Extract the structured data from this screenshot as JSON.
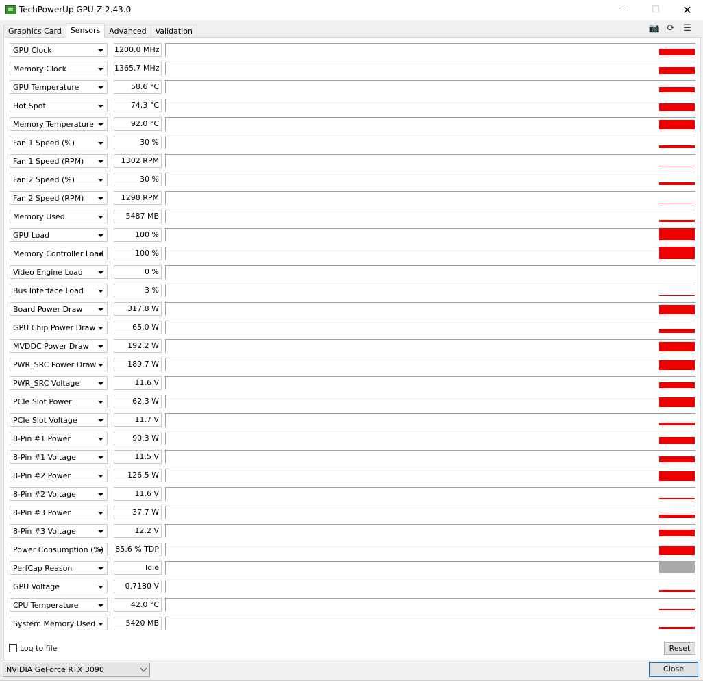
{
  "window": {
    "title": "TechPowerUp GPU-Z 2.43.0",
    "min_glyph": "—",
    "max_glyph": "☐",
    "close_glyph": "✕"
  },
  "tabs": [
    {
      "label": "Graphics Card"
    },
    {
      "label": "Sensors",
      "active": true
    },
    {
      "label": "Advanced"
    },
    {
      "label": "Validation"
    }
  ],
  "toolbar": {
    "camera_glyph": "📷",
    "refresh_glyph": "⟳",
    "menu_glyph": "☰"
  },
  "accent_colors": {
    "graph": "#ec0000",
    "graph_inactive": "#a9a9a9"
  },
  "sensors": [
    {
      "name": "GPU Clock",
      "value": "1200.0 MHz",
      "level": 0.55
    },
    {
      "name": "Memory Clock",
      "value": "1365.7 MHz",
      "level": 0.55
    },
    {
      "name": "GPU Temperature",
      "value": "58.6 °C",
      "level": 0.45
    },
    {
      "name": "Hot Spot",
      "value": "74.3 °C",
      "level": 0.6
    },
    {
      "name": "Memory Temperature",
      "value": "92.0 °C",
      "level": 0.75
    },
    {
      "name": "Fan 1 Speed (%)",
      "value": "30 %",
      "level": 0.2
    },
    {
      "name": "Fan 1 Speed (RPM)",
      "value": "1302 RPM",
      "level": 0.07
    },
    {
      "name": "Fan 2 Speed (%)",
      "value": "30 %",
      "level": 0.2
    },
    {
      "name": "Fan 2 Speed (RPM)",
      "value": "1298 RPM",
      "level": 0.07
    },
    {
      "name": "Memory Used",
      "value": "5487 MB",
      "level": 0.15
    },
    {
      "name": "GPU Load",
      "value": "100 %",
      "level": 1.0
    },
    {
      "name": "Memory Controller Load",
      "value": "100 %",
      "level": 1.0
    },
    {
      "name": "Video Engine Load",
      "value": "0 %",
      "level": 0.0
    },
    {
      "name": "Bus Interface Load",
      "value": "3 %",
      "level": 0.05
    },
    {
      "name": "Board Power Draw",
      "value": "317.8 W",
      "level": 0.75
    },
    {
      "name": "GPU Chip Power Draw",
      "value": "65.0 W",
      "level": 0.35
    },
    {
      "name": "MVDDC Power Draw",
      "value": "192.2 W",
      "level": 0.8
    },
    {
      "name": "PWR_SRC Power Draw",
      "value": "189.7 W",
      "level": 0.75
    },
    {
      "name": "PWR_SRC Voltage",
      "value": "11.6 V",
      "level": 0.5
    },
    {
      "name": "PCIe Slot Power",
      "value": "62.3 W",
      "level": 0.75
    },
    {
      "name": "PCIe Slot Voltage",
      "value": "11.7 V",
      "level": 0.2
    },
    {
      "name": "8-Pin #1 Power",
      "value": "90.3 W",
      "level": 0.55
    },
    {
      "name": "8-Pin #1 Voltage",
      "value": "11.5 V",
      "level": 0.5
    },
    {
      "name": "8-Pin #2 Power",
      "value": "126.5 W",
      "level": 0.75
    },
    {
      "name": "8-Pin #2 Voltage",
      "value": "11.6 V",
      "level": 0.1
    },
    {
      "name": "8-Pin #3 Power",
      "value": "37.7 W",
      "level": 0.25
    },
    {
      "name": "8-Pin #3 Voltage",
      "value": "12.2 V",
      "level": 0.55
    },
    {
      "name": "Power Consumption (%)",
      "value": "85.6 % TDP",
      "level": 0.7
    },
    {
      "name": "PerfCap Reason",
      "value": "Idle",
      "level": 1.0,
      "inactive": true
    },
    {
      "name": "GPU Voltage",
      "value": "0.7180 V",
      "level": 0.15
    },
    {
      "name": "CPU Temperature",
      "value": "42.0 °C",
      "level": 0.1
    },
    {
      "name": "System Memory Used",
      "value": "5420 MB",
      "level": 0.15
    }
  ],
  "footer": {
    "log_to_file_label": "Log to file",
    "log_to_file_checked": false,
    "reset_label": "Reset",
    "gpu_select_value": "NVIDIA GeForce RTX 3090",
    "close_label": "Close"
  }
}
